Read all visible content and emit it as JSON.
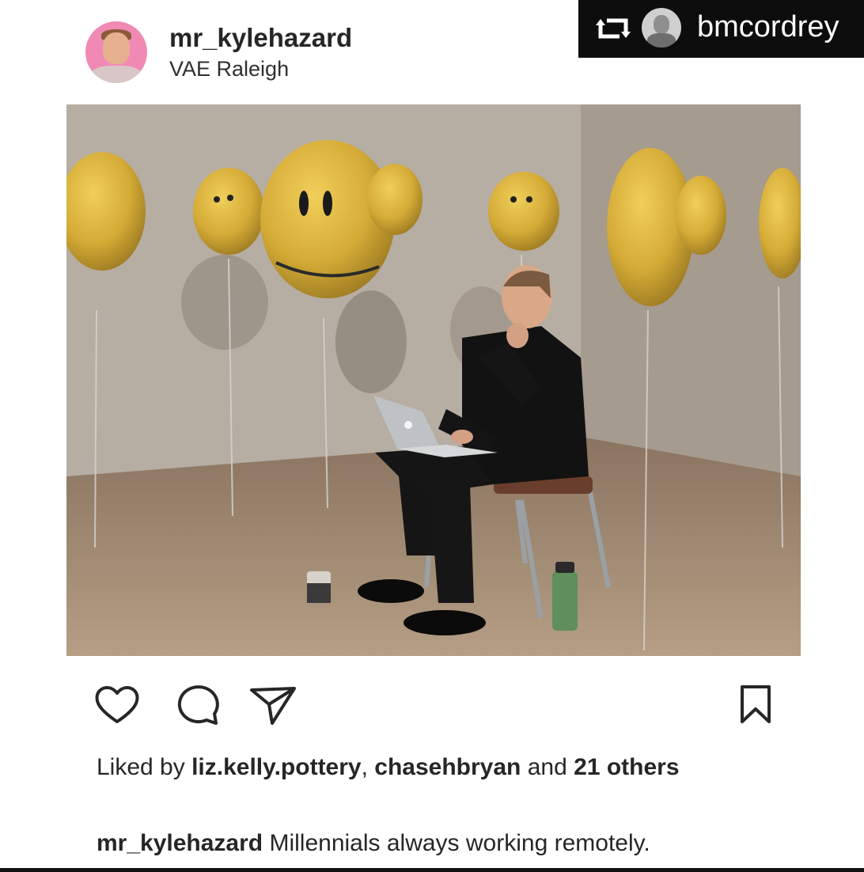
{
  "post": {
    "username": "mr_kylehazard",
    "location": "VAE Raleigh"
  },
  "repost": {
    "username": "bmcordrey"
  },
  "likes": {
    "prefix": "Liked by",
    "user1": "liz.kelly.pottery",
    "sep": ",",
    "user2": "chasehbryan",
    "and": "and",
    "count": "21",
    "others": "others"
  },
  "caption": {
    "username": "mr_kylehazard",
    "text": "Millennials always working remotely."
  },
  "icons": [
    "heart-icon",
    "comment-icon",
    "share-icon",
    "bookmark-icon",
    "repost-icon"
  ],
  "colors": {
    "repost_bg": "#0d0d0d",
    "avatar_ring": "#f08ab4",
    "balloon": "#d9b43a"
  }
}
